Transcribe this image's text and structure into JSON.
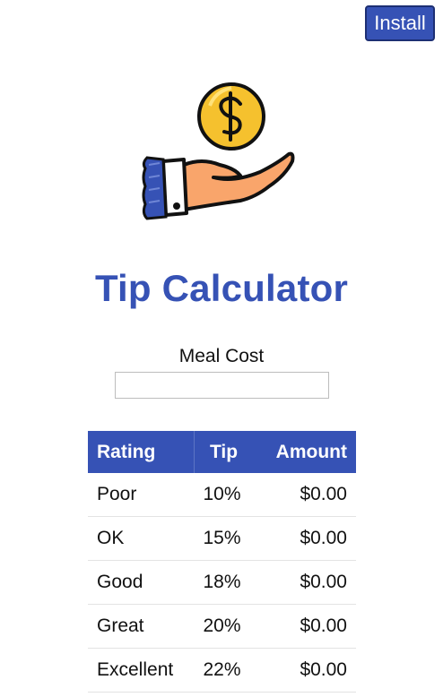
{
  "header": {
    "install_label": "Install"
  },
  "app": {
    "title": "Tip Calculator"
  },
  "meal": {
    "label": "Meal Cost",
    "value": "",
    "placeholder": ""
  },
  "table": {
    "headers": {
      "rating": "Rating",
      "tip": "Tip",
      "amount": "Amount"
    },
    "rows": [
      {
        "rating": "Poor",
        "tip": "10%",
        "amount": "$0.00"
      },
      {
        "rating": "OK",
        "tip": "15%",
        "amount": "$0.00"
      },
      {
        "rating": "Good",
        "tip": "18%",
        "amount": "$0.00"
      },
      {
        "rating": "Great",
        "tip": "20%",
        "amount": "$0.00"
      },
      {
        "rating": "Excellent",
        "tip": "22%",
        "amount": "$0.00"
      }
    ]
  },
  "colors": {
    "accent": "#3652b5",
    "coin": "#f5c12e",
    "hand": "#f9a56b"
  }
}
